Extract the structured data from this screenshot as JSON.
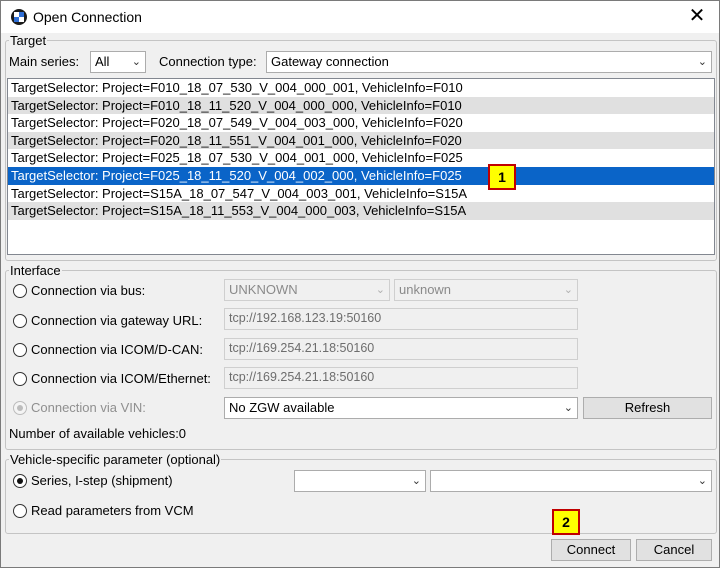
{
  "window": {
    "title": "Open Connection",
    "close_glyph": "✕"
  },
  "target": {
    "legend": "Target",
    "main_series_label": "Main series:",
    "main_series_value": "All",
    "connection_type_label": "Connection type:",
    "connection_type_value": "Gateway connection",
    "items": [
      "TargetSelector: Project=F010_18_07_530_V_004_000_001, VehicleInfo=F010",
      "TargetSelector: Project=F010_18_11_520_V_004_000_000, VehicleInfo=F010",
      "TargetSelector: Project=F020_18_07_549_V_004_003_000, VehicleInfo=F020",
      "TargetSelector: Project=F020_18_11_551_V_004_001_000, VehicleInfo=F020",
      "TargetSelector: Project=F025_18_07_530_V_004_001_000, VehicleInfo=F025",
      "TargetSelector: Project=F025_18_11_520_V_004_002_000, VehicleInfo=F025",
      "TargetSelector: Project=S15A_18_07_547_V_004_003_001, VehicleInfo=S15A",
      "TargetSelector: Project=S15A_18_11_553_V_004_000_003, VehicleInfo=S15A"
    ],
    "selected_index": 5
  },
  "interface": {
    "legend": "Interface",
    "bus_label": "Connection via bus:",
    "bus_value": "UNKNOWN",
    "bus_sub_value": "unknown",
    "gateway_label": "Connection via gateway URL:",
    "gateway_value": "tcp://192.168.123.19:50160",
    "icom_dcan_label": "Connection via ICOM/D-CAN:",
    "icom_dcan_value": "tcp://169.254.21.18:50160",
    "icom_eth_label": "Connection via ICOM/Ethernet:",
    "icom_eth_value": "tcp://169.254.21.18:50160",
    "vin_label": "Connection via VIN:",
    "vin_value": "No ZGW available",
    "refresh_label": "Refresh",
    "available_label": "Number of available vehicles:0"
  },
  "vehicle": {
    "legend": "Vehicle-specific parameter (optional)",
    "series_label": "Series, I-step (shipment)",
    "series_value": "",
    "istep_value": "",
    "vcm_label": "Read parameters from VCM"
  },
  "footer": {
    "connect_label": "Connect",
    "cancel_label": "Cancel"
  },
  "annotations": {
    "badge1": "1",
    "badge2": "2"
  },
  "icons": [
    "app-icon",
    "close-icon",
    "chevron-down-icon"
  ]
}
